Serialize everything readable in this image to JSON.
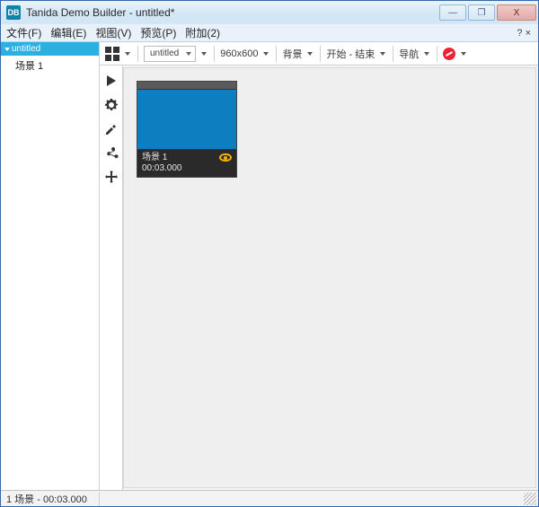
{
  "app": {
    "icon_text": "DB",
    "title": "Tanida Demo Builder - untitled*"
  },
  "window_controls": {
    "minimize": "—",
    "maximize": "❐",
    "close": "X"
  },
  "menu": {
    "file": "文件(F)",
    "edit": "编辑(E)",
    "view": "视图(V)",
    "preview": "预览(P)",
    "extra": "附加(2)",
    "help": "? ×"
  },
  "tree": {
    "root": "untitled",
    "child": "场景 1"
  },
  "toolbar": {
    "combo_value": "untitled",
    "resolution": "960x600",
    "background": "背景",
    "start_end": "开始 - 结束",
    "navigation": "导航"
  },
  "scene": {
    "name": "场景 1",
    "time": "00:03.000"
  },
  "status": {
    "left": "1 场景 - 00:03.000"
  }
}
